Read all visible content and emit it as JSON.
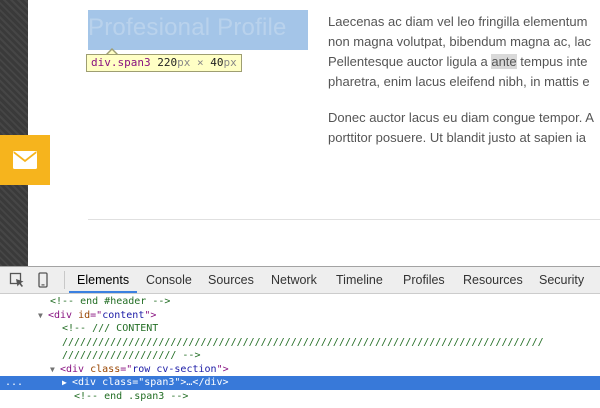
{
  "page": {
    "profile_title": "Profesional Profile",
    "tooltip": {
      "selector": "div.span3",
      "width": "220",
      "height": "40",
      "unit": "px",
      "times": "×"
    },
    "paragraphs": [
      {
        "lines": [
          "Laecenas ac diam vel leo fringilla elementum",
          "non magna volutpat, bibendum magna ac, lac",
          "Pellentesque auctor ligula a ",
          "pharetra, enim lacus eleifend nibh, in mattis e"
        ],
        "highlighted_word": "ante",
        "after_highlight": " tempus inte"
      },
      {
        "lines": [
          "Donec auctor lacus eu diam congue tempor. A",
          "porttitor posuere. Ut blandit justo at sapien ia"
        ]
      }
    ],
    "mail_icon": "envelope-icon",
    "accent_color": "#f6b41d"
  },
  "devtools": {
    "tabs": [
      "Elements",
      "Console",
      "Sources",
      "Network",
      "Timeline",
      "Profiles",
      "Resources",
      "Security"
    ],
    "active_tab": "Elements",
    "dom_lines": {
      "l0": "<!-- end #header -->",
      "l1_tag_open": "<div ",
      "l1_attr": "id",
      "l1_eq": "=\"",
      "l1_val": "content",
      "l1_close": "\">",
      "l2": "<!-- /// CONTENT",
      "l3": "////////////////////////////////////////////////////////////////////////////////",
      "l4": "/////////////////// -->",
      "l5_tag_open": "<div ",
      "l5_attr": "class",
      "l5_eq": "=\"",
      "l5_val": "row cv-section",
      "l5_close": "\">",
      "l6_tag_open": "<div ",
      "l6_attr": "class",
      "l6_eq": "=\"",
      "l6_val": "span3",
      "l6_close": "\">…</div>",
      "l7": "<!-- end .span3 -->"
    },
    "selected_line_prefix": "..."
  }
}
